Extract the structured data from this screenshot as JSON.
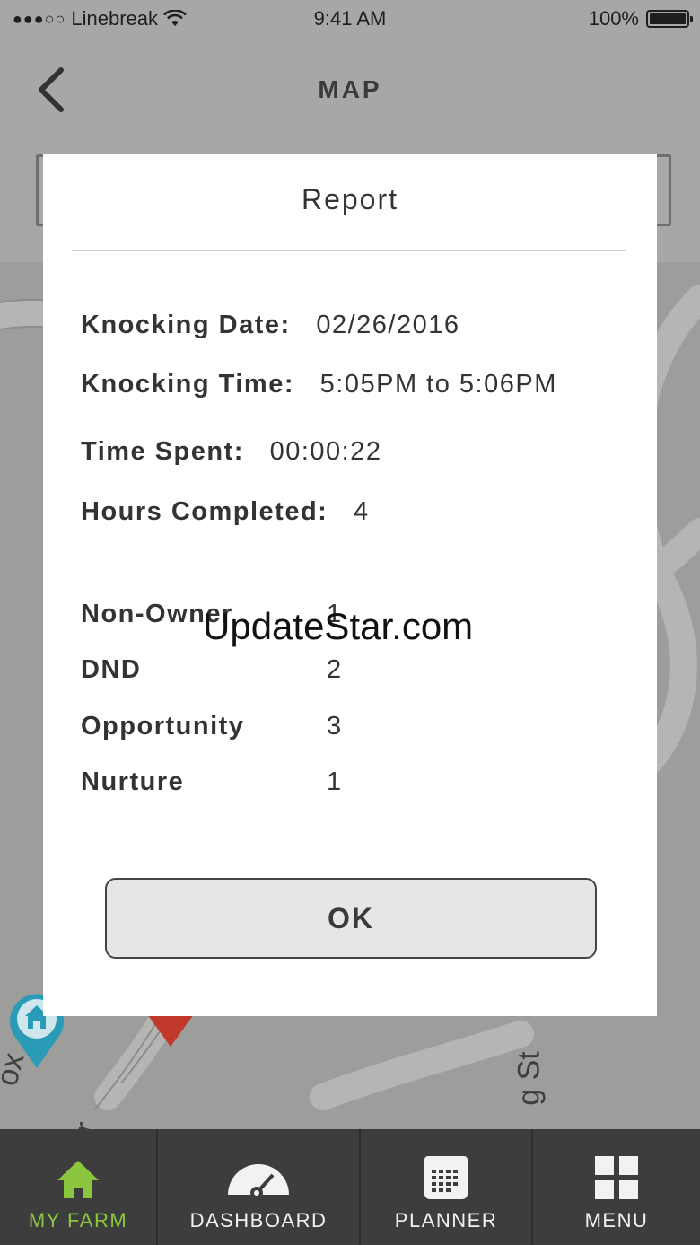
{
  "status_bar": {
    "carrier": "Linebreak",
    "time": "9:41 AM",
    "battery": "100%"
  },
  "nav": {
    "title": "MAP"
  },
  "map": {
    "street_labels": [
      "ox",
      "g St",
      "r"
    ]
  },
  "report": {
    "title": "Report",
    "knocking_date_label": "Knocking Date:",
    "knocking_date_value": "02/26/2016",
    "knocking_time_label": "Knocking Time:",
    "knocking_time_value": "5:05PM to 5:06PM",
    "time_spent_label": "Time Spent:",
    "time_spent_value": "00:00:22",
    "hours_completed_label": "Hours Completed:",
    "hours_completed_value": "4",
    "categories": [
      {
        "label": "Non-Owner",
        "value": "1"
      },
      {
        "label": "DND",
        "value": "2"
      },
      {
        "label": "Opportunity",
        "value": "3"
      },
      {
        "label": "Nurture",
        "value": "1"
      }
    ],
    "ok_label": "OK"
  },
  "watermark": "UpdateStar.com",
  "tabs": [
    {
      "label": "MY FARM",
      "icon": "home-icon",
      "active": true
    },
    {
      "label": "DASHBOARD",
      "icon": "gauge-icon",
      "active": false
    },
    {
      "label": "PLANNER",
      "icon": "calendar-icon",
      "active": false
    },
    {
      "label": "MENU",
      "icon": "grid-icon",
      "active": false
    }
  ],
  "colors": {
    "active_tab": "#8cc63f",
    "tab_bar": "#3d3d3d",
    "pin_home": "#2a9bb7",
    "pin_red": "#c0392b"
  }
}
